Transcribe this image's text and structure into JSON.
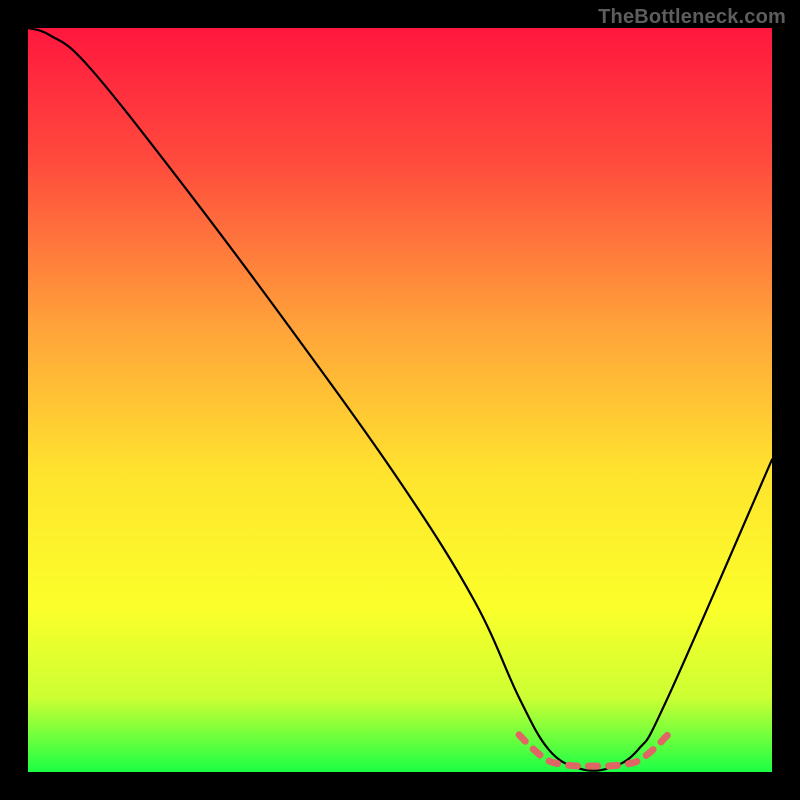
{
  "watermark": "TheBottleneck.com",
  "chart_data": {
    "type": "line",
    "title": "",
    "xlabel": "",
    "ylabel": "",
    "xlim": [
      0,
      100
    ],
    "ylim": [
      0,
      100
    ],
    "gradient_stops": [
      {
        "offset": 0,
        "color": "#ff173e"
      },
      {
        "offset": 18,
        "color": "#ff4b3d"
      },
      {
        "offset": 40,
        "color": "#ffa23a"
      },
      {
        "offset": 60,
        "color": "#ffe42e"
      },
      {
        "offset": 78,
        "color": "#fbff2a"
      },
      {
        "offset": 90,
        "color": "#ccff33"
      },
      {
        "offset": 100,
        "color": "#1bff45"
      }
    ],
    "series": [
      {
        "name": "bottleneck-curve",
        "x": [
          0,
          3,
          8,
          20,
          35,
          50,
          60,
          66,
          70,
          74,
          78,
          82,
          86,
          100
        ],
        "values": [
          100,
          99,
          95,
          80,
          60,
          39,
          23,
          10,
          3,
          0.5,
          0.5,
          3,
          10,
          42
        ]
      }
    ],
    "optimal_range": {
      "x_start": 66,
      "x_end": 86,
      "value": 0.5
    },
    "markers": {
      "comment": "flat/optimal zone indicator",
      "x": [
        66,
        68,
        70,
        72,
        74,
        76,
        78,
        80,
        82,
        84,
        86
      ],
      "values": [
        5,
        3,
        1.5,
        1,
        0.8,
        0.8,
        0.8,
        1,
        1.5,
        3,
        5
      ]
    }
  }
}
